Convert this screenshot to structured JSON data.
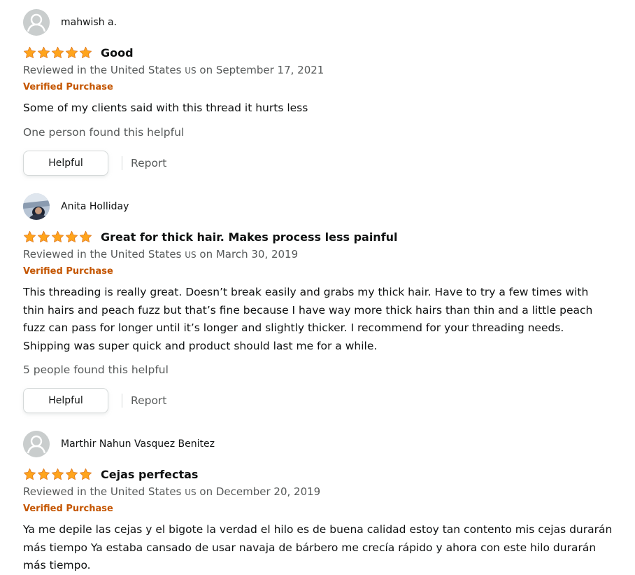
{
  "colors": {
    "star": "#ffa41c",
    "verified": "#c45500",
    "secondary_text": "#565959",
    "primary_text": "#0f1111"
  },
  "reviews": [
    {
      "profile_name": "mahwish a.",
      "avatar": "default-avatar-icon",
      "rating": 5,
      "title": "Good",
      "date_prefix": "Reviewed in the United States",
      "country_code": "US",
      "date_suffix": "on September 17, 2021",
      "verified_label": "Verified Purchase",
      "body": "Some of my clients said with this thread it hurts less",
      "helpful_count": "One person found this helpful",
      "helpful_button": "Helpful",
      "report_label": "Report"
    },
    {
      "profile_name": "Anita Holliday",
      "avatar": "user-photo-avatar",
      "rating": 5,
      "title": "Great for thick hair. Makes process less painful",
      "date_prefix": "Reviewed in the United States",
      "country_code": "US",
      "date_suffix": "on March 30, 2019",
      "verified_label": "Verified Purchase",
      "body": "This threading is really great. Doesn’t break easily and grabs my thick hair. Have to try a few times with\nthin hairs and peach fuzz but that’s fine because I have way more thick hairs than thin and a little peach\nfuzz can pass for longer until it’s longer and slightly thicker. I recommend for your threading needs.\nShipping was super quick and product should last me for a while.",
      "helpful_count": "5 people found this helpful",
      "helpful_button": "Helpful",
      "report_label": "Report"
    },
    {
      "profile_name": "Marthir Nahun Vasquez Benitez",
      "avatar": "default-avatar-icon",
      "rating": 5,
      "title": "Cejas perfectas",
      "date_prefix": "Reviewed in the United States",
      "country_code": "US",
      "date_suffix": "on December 20, 2019",
      "verified_label": "Verified Purchase",
      "body": "Ya me depile las cejas y el bigote la verdad el hilo es de buena calidad estoy tan contento mis cejas durarán\nmás tiempo Ya estaba cansado de usar navaja de bárbero me crecía rápido y ahora con este hilo durarán\nmás tiempo."
    }
  ]
}
